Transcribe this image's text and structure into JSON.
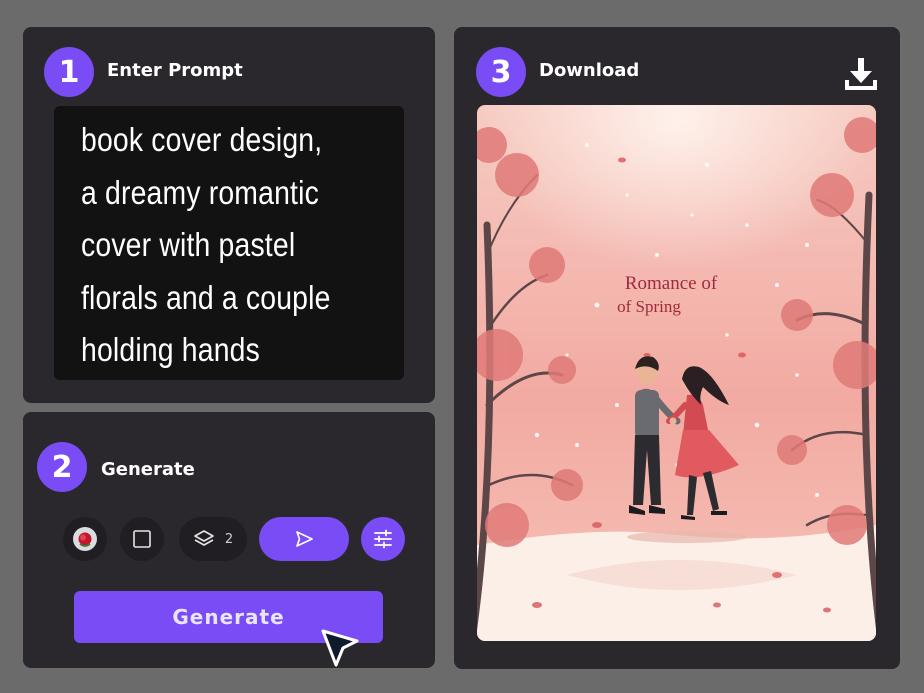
{
  "steps": {
    "prompt": {
      "number": "1",
      "title": "Enter Prompt"
    },
    "generate": {
      "number": "2",
      "title": "Generate"
    },
    "download": {
      "number": "3",
      "title": "Download"
    }
  },
  "prompt": {
    "lines": [
      "book cover design,",
      "a dreamy romantic",
      "cover with pastel",
      "florals and a couple",
      "holding hands"
    ]
  },
  "toolbar": {
    "layers_count": "2",
    "icons": [
      "rose-thumbnail-icon",
      "square-icon",
      "layers-icon",
      "send-icon",
      "sliders-icon"
    ]
  },
  "generate_button": {
    "label": "Generate"
  },
  "cover": {
    "title_line1": "Romance of",
    "title_line2": "of Spring"
  },
  "colors": {
    "accent": "#7a4cf5",
    "panel": "#2a282c",
    "background": "#6b6b6b",
    "cover_pink": "#f2a9a2",
    "cover_title": "#9e2a3a"
  }
}
